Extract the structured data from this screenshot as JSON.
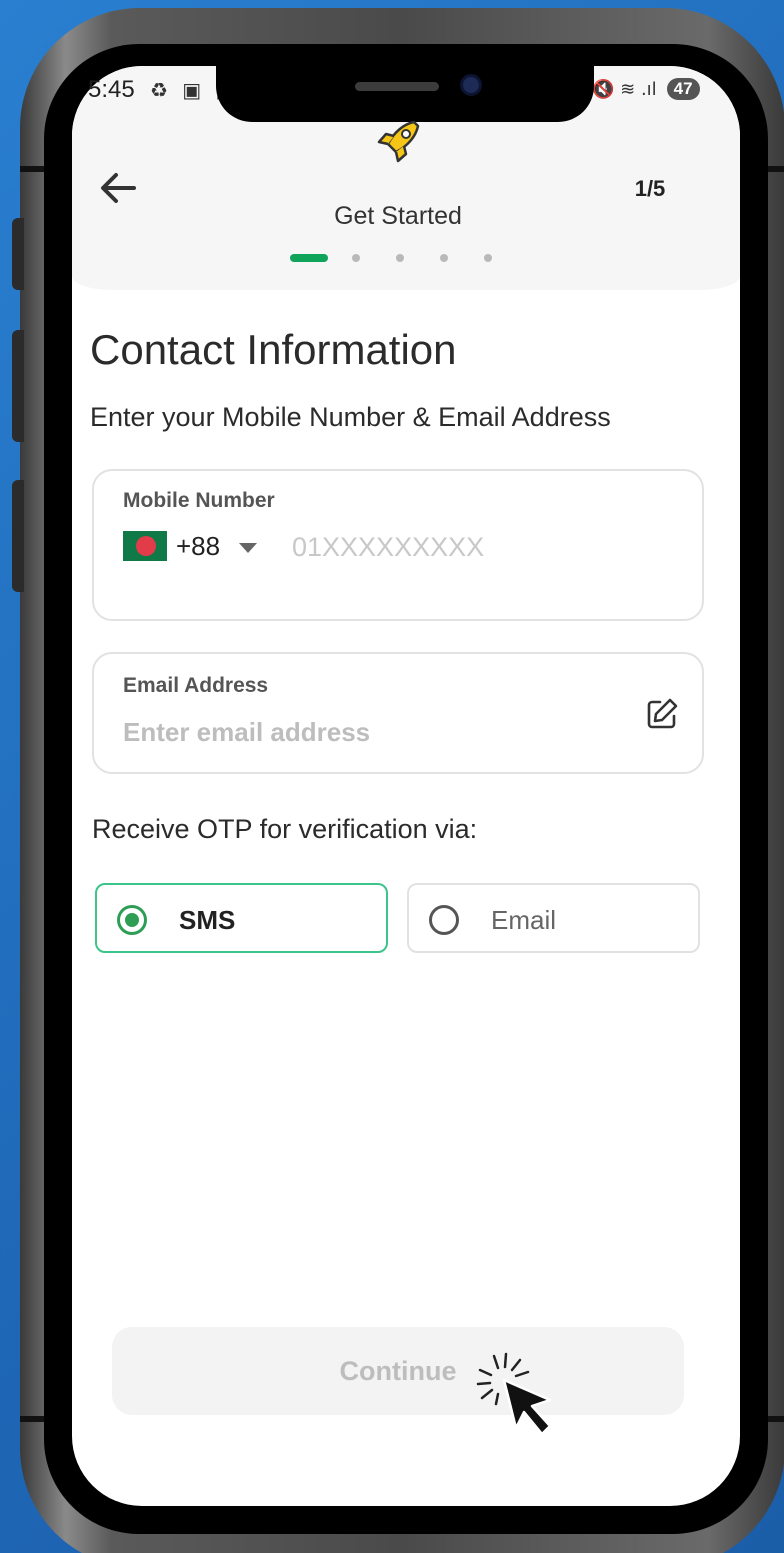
{
  "status_bar": {
    "time": "5:45",
    "left_icons": "♻ ▣ ▤",
    "right_icons": "🔇 ≋ .ıl",
    "battery": "47"
  },
  "header": {
    "title": "Get Started",
    "step_count": "1/5",
    "progress": {
      "current": 1,
      "total": 5
    }
  },
  "page": {
    "title": "Contact Information",
    "subtitle": "Enter your Mobile Number & Email Address"
  },
  "mobile_field": {
    "label": "Mobile Number",
    "country_code": "+88",
    "placeholder": "01XXXXXXXXX"
  },
  "email_field": {
    "label": "Email Address",
    "placeholder": "Enter email address"
  },
  "otp": {
    "label": "Receive OTP for verification via:",
    "options": [
      {
        "label": "SMS",
        "selected": true
      },
      {
        "label": "Email",
        "selected": false
      }
    ]
  },
  "continue_button": {
    "label": "Continue",
    "enabled": false
  },
  "colors": {
    "accent_green": "#10a35a",
    "selected_border": "#3cc48a",
    "background_blue": "#1f6fbf"
  }
}
